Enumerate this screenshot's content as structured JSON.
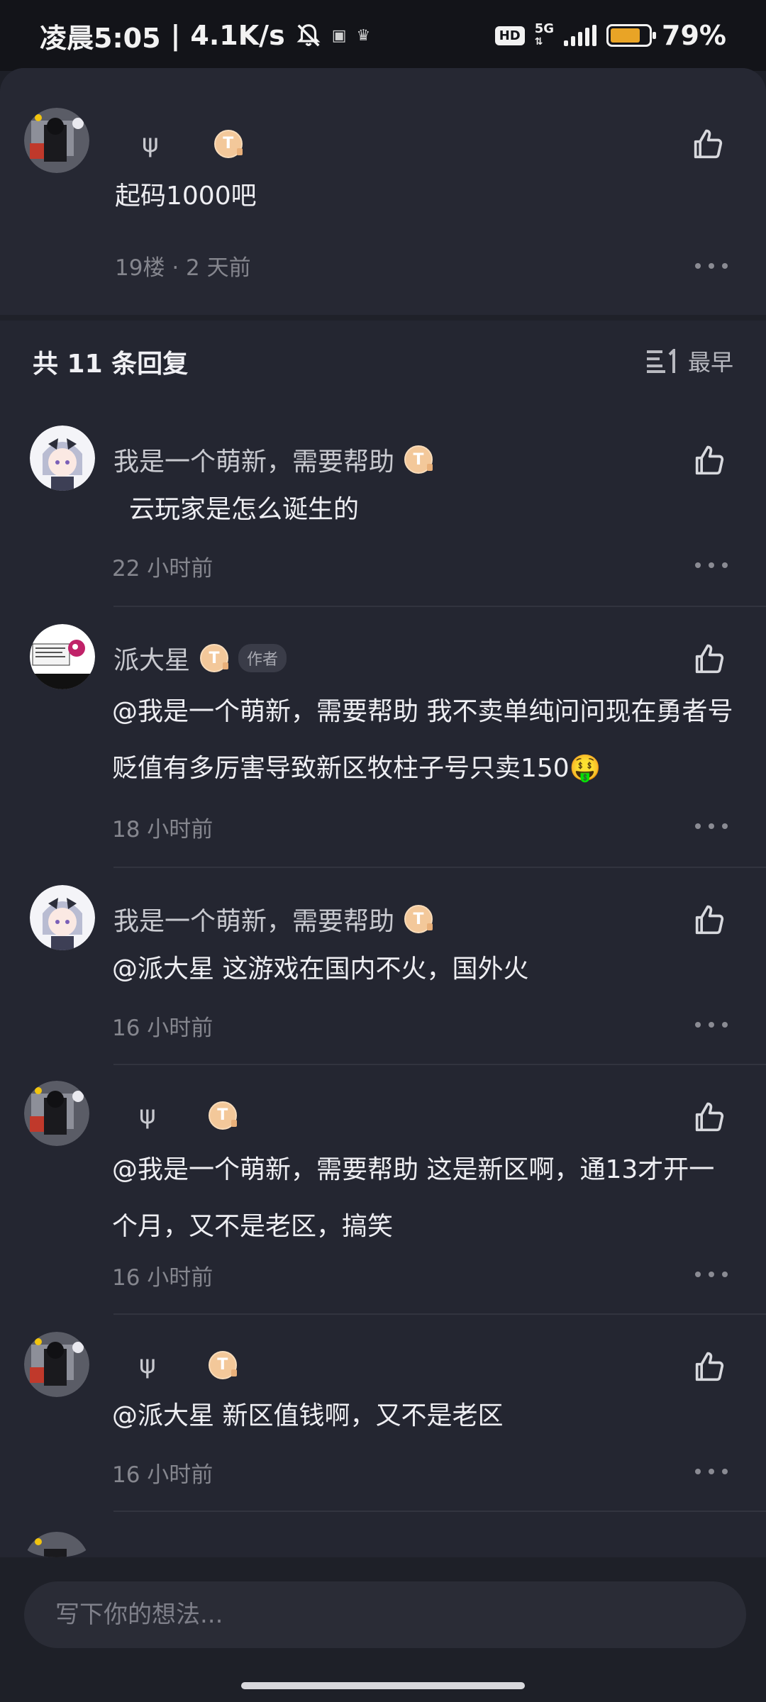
{
  "status": {
    "time": "凌晨5:05",
    "net_speed": "4.1K/s",
    "hd": "HD",
    "network": "5G",
    "battery_level": 0.79,
    "battery_text": "79%"
  },
  "parent": {
    "username": "ψ",
    "text": "起码1000吧",
    "floor": "19楼",
    "time": "2 天前"
  },
  "replies_header": {
    "count_label": "共 11 条回复",
    "sort_label": "最早"
  },
  "replies": [
    {
      "username": "我是一个萌新，需要帮助",
      "badge": "T",
      "author": false,
      "text": "云玩家是怎么诞生的",
      "time": "22 小时前"
    },
    {
      "username": "派大星",
      "badge": "T",
      "author": true,
      "author_label": "作者",
      "text": "@我是一个萌新，需要帮助  我不卖单纯问问现在勇者号贬值有多厉害导致新区牧柱子号只卖150🤑",
      "time": "18 小时前"
    },
    {
      "username": "我是一个萌新，需要帮助",
      "badge": "T",
      "author": false,
      "text": "@派大星  这游戏在国内不火，国外火",
      "time": "16 小时前"
    },
    {
      "username": "ψ",
      "badge": "T",
      "author": false,
      "text": "@我是一个萌新，需要帮助  这是新区啊，通13才开一个月，又不是老区，搞笑",
      "time": "16 小时前"
    },
    {
      "username": "ψ",
      "badge": "T",
      "author": false,
      "text": "@派大星  新区值钱啊，又不是老区",
      "time": "16 小时前"
    }
  ],
  "composer": {
    "placeholder": "写下你的想法..."
  },
  "colors": {
    "background": "#242631",
    "accent_badge": "#f3c89a",
    "battery": "#e9a426"
  }
}
